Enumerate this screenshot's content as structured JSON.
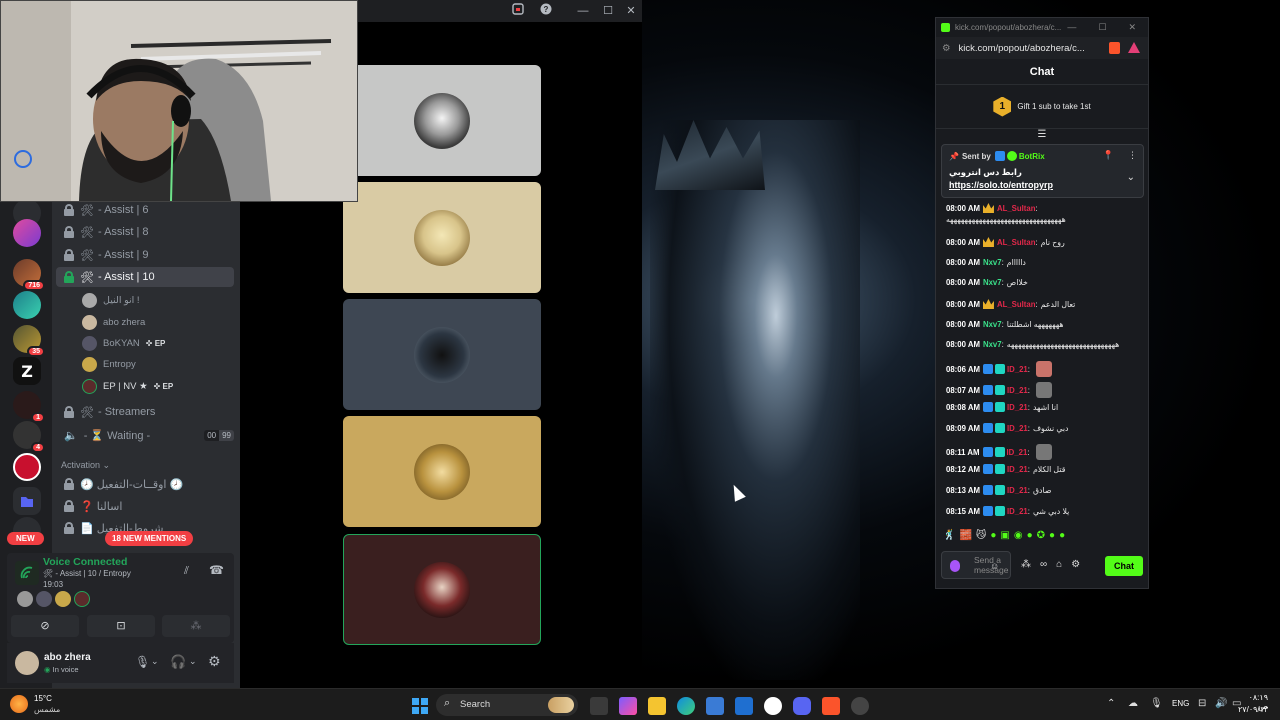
{
  "discord": {
    "channels": [
      {
        "label": "- Assist | 6",
        "active": false
      },
      {
        "label": "- Assist | 8",
        "active": false
      },
      {
        "label": "- Assist | 9",
        "active": false
      },
      {
        "label": "- Assist | 10",
        "active": true
      }
    ],
    "members": [
      {
        "name": "انو النيل !",
        "ep": ""
      },
      {
        "name": "abo zhera",
        "ep": ""
      },
      {
        "name": "BoKYAN",
        "ep": "✜ EP"
      },
      {
        "name": "Entropy",
        "ep": ""
      },
      {
        "name": "EP | NV ★",
        "ep": "✜ EP"
      }
    ],
    "streamers": "- Streamers",
    "waiting": "- ⏳ Waiting -",
    "waiting_count_a": "00",
    "waiting_count_b": "99",
    "activation_header": "Activation",
    "activation_items": [
      "🕗 اوقــات-التفعيل 🕗",
      "❓ اسالنا",
      "📄 شروط-التفعيل"
    ],
    "guild_badges": [
      "716",
      "35",
      "1",
      "4"
    ],
    "new_pill": "NEW",
    "mentions_pill": "18 NEW MENTIONS",
    "voice": {
      "status": "Voice Connected",
      "channel": "- Assist | 10 / Entropy",
      "time": "19:03"
    },
    "user": {
      "name": "abo zhera",
      "status": "In voice"
    }
  },
  "kick": {
    "window_title": "kick.com/popout/abozhera/c...",
    "url": "kick.com/popout/abozhera/c...",
    "header": "Chat",
    "gift_count": "1",
    "gift_text": "Gift 1 sub to take 1st",
    "pinned": {
      "sent_by_label": "Sent by",
      "sender": "BotRix",
      "title": "رابط دس انتروبي",
      "link": "https://solo.to/entropyrp"
    },
    "messages": [
      {
        "time": "08:00 AM",
        "user": "AL_Sultan",
        "color": "red",
        "badge": "crown",
        "text": "ههههههههههههههههههههههههههههههههه",
        "wrap": true
      },
      {
        "time": "08:00 AM",
        "user": "AL_Sultan",
        "color": "red",
        "badge": "crown",
        "text": "روح نام"
      },
      {
        "time": "08:00 AM",
        "user": "Nxv7",
        "color": "green",
        "badge": "",
        "text": "دااااام"
      },
      {
        "time": "08:00 AM",
        "user": "Nxv7",
        "color": "green",
        "badge": "",
        "text": "خلااص"
      },
      {
        "time": "08:00 AM",
        "user": "AL_Sultan",
        "color": "red",
        "badge": "crown",
        "text": "تعال الدعم"
      },
      {
        "time": "08:00 AM",
        "user": "Nxv7",
        "color": "green",
        "badge": "",
        "text": "هههههههه اشطلتنا"
      },
      {
        "time": "08:00 AM",
        "user": "Nxv7",
        "color": "green",
        "badge": "",
        "text": "ههههههههههههههههههههههههههههههه"
      },
      {
        "time": "08:06 AM",
        "user": "ID_21",
        "color": "red",
        "badge": "sq",
        "text": "",
        "emote": true
      },
      {
        "time": "08:07 AM",
        "user": "ID_21",
        "color": "red",
        "badge": "sq",
        "text": "",
        "emote": true
      },
      {
        "time": "08:08 AM",
        "user": "ID_21",
        "color": "red",
        "badge": "sq",
        "text": "انا اشهد"
      },
      {
        "time": "08:09 AM",
        "user": "ID_21",
        "color": "red",
        "badge": "sq",
        "text": "دبي نشوف"
      },
      {
        "time": "08:11 AM",
        "user": "ID_21",
        "color": "red",
        "badge": "sq",
        "text": "",
        "emote": true
      },
      {
        "time": "08:12 AM",
        "user": "ID_21",
        "color": "red",
        "badge": "sq",
        "text": "قتل الكلام"
      },
      {
        "time": "08:13 AM",
        "user": "ID_21",
        "color": "red",
        "badge": "sq",
        "text": "صادق"
      },
      {
        "time": "08:15 AM",
        "user": "ID_21",
        "color": "red",
        "badge": "sq",
        "text": "يلا دبي شي"
      }
    ],
    "input_placeholder": "Send a message",
    "chat_button": "Chat"
  },
  "taskbar": {
    "weather_temp": "15°C",
    "weather_desc": "مشمس",
    "search_placeholder": "Search",
    "lang": "ENG",
    "time": "٠٨:١٩ ص",
    "date": "٢٧/٠٩/١٣"
  },
  "colors": {
    "kick_green": "#53fc18",
    "discord_red": "#f23f43",
    "discord_green": "#23a55a"
  }
}
